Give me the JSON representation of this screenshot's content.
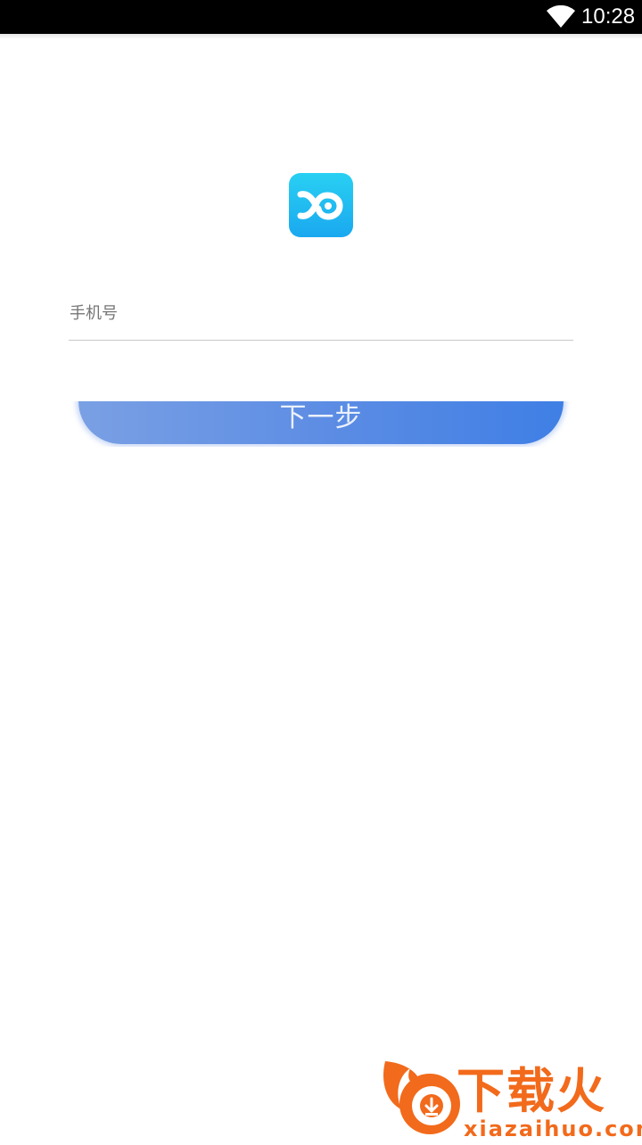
{
  "status_bar": {
    "time": "10:28"
  },
  "login": {
    "phone_placeholder": "手机号",
    "phone_value": "",
    "next_label": "下一步"
  },
  "watermark": {
    "title": "下载火",
    "url": "xiazaihuo.com"
  },
  "colors": {
    "status_bar_bg": "#000000",
    "logo_gradient_top": "#29d0f2",
    "logo_gradient_bottom": "#1aa8f0",
    "button_gradient_left": "#7aa0e4",
    "button_gradient_right": "#3f7fe5",
    "watermark_orange": "#f26a1b"
  },
  "icons": {
    "wifi": "wifi-icon",
    "logo": "app-logo-icon",
    "watermark": "xiazaihuo-logo-icon"
  }
}
